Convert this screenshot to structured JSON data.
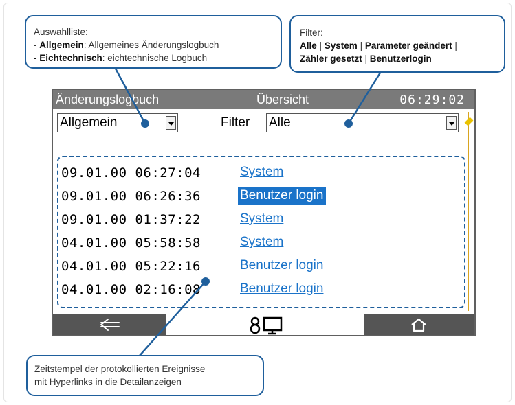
{
  "callouts": {
    "selection_list": {
      "title": "Auswahlliste:",
      "line1_prefix": "- ",
      "line1_bold": "Allgemein",
      "line1_rest": ": Allgemeines Änderungslogbuch",
      "line2_prefix": "- ",
      "line2_bold": "Eichtechnisch",
      "line2_rest": ": eichtechnische Logbuch"
    },
    "filter": {
      "title": "Filter:",
      "opt1": "Alle",
      "opt2": "System",
      "opt3": "Parameter geändert",
      "opt4": "Zähler gesetzt",
      "opt5": "Benutzerlogin",
      "sep": " | "
    },
    "timestamps": {
      "line1": "Zeitstempel der protokollierten Ereignisse",
      "line2": "mit Hyperlinks in die Detailanzeigen"
    }
  },
  "screen": {
    "title_left": "Änderungslogbuch",
    "title_mid": "Übersicht",
    "clock": "06:29:02",
    "mode_select": {
      "value": "Allgemein"
    },
    "filter_label": "Filter",
    "filter_select": {
      "value": "Alle"
    },
    "log_rows": [
      {
        "timestamp": "09.01.00 06:27:04",
        "event": "System",
        "selected": false
      },
      {
        "timestamp": "09.01.00 06:26:36",
        "event": "Benutzer login",
        "selected": true
      },
      {
        "timestamp": "09.01.00 01:37:22",
        "event": "System",
        "selected": false
      },
      {
        "timestamp": "04.01.00 05:58:58",
        "event": "System",
        "selected": false
      },
      {
        "timestamp": "04.01.00 05:22:16",
        "event": "Benutzer login",
        "selected": false
      },
      {
        "timestamp": "04.01.00 02:16:08",
        "event": "Benutzer login",
        "selected": false
      }
    ],
    "footer": {
      "back_icon": "left-arrow-icon",
      "mid_icons": [
        "user-icon",
        "monitor-icon"
      ],
      "home_icon": "home-icon"
    }
  },
  "colors": {
    "callout_border": "#1f5f9c",
    "link": "#1a73c9",
    "selected_bg": "#1a73c9",
    "titlebar_bg": "#7a7a7a",
    "footer_bg": "#555555",
    "scroll_accent": "#e9c200"
  }
}
